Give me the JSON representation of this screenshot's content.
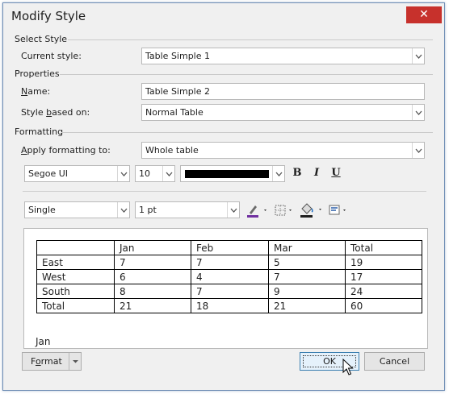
{
  "window": {
    "title": "Modify Style",
    "close_glyph": "✕"
  },
  "select_style": {
    "section_label": "Select Style",
    "current_style_label": "Current style:",
    "current_style_value": "Table Simple 1"
  },
  "properties": {
    "section_label": "Properties",
    "name_label_first": "N",
    "name_label_rest": "ame:",
    "name_value": "Table Simple 2",
    "based_on_label_pre": "Style ",
    "based_on_label_u": "b",
    "based_on_label_post": "ased on:",
    "based_on_value": "Normal Table"
  },
  "formatting": {
    "section_label": "Formatting",
    "apply_label_first": "A",
    "apply_label_rest": "pply formatting to:",
    "apply_value": "Whole table",
    "font_name": "Segoe UI",
    "font_size": "10",
    "font_color": "#000000",
    "bold_label": "B",
    "italic_label": "I",
    "underline_label": "U",
    "border_style": "Single",
    "border_width": "1 pt"
  },
  "preview": {
    "table": {
      "header": [
        "",
        "Jan",
        "Feb",
        "Mar",
        "Total"
      ],
      "rows": [
        [
          "East",
          "7",
          "7",
          "5",
          "19"
        ],
        [
          "West",
          "6",
          "4",
          "7",
          "17"
        ],
        [
          "South",
          "8",
          "7",
          "9",
          "24"
        ],
        [
          "Total",
          "21",
          "18",
          "21",
          "60"
        ]
      ]
    },
    "caption": "Jan"
  },
  "footer": {
    "format_label_pre": "F",
    "format_label_u": "o",
    "format_label_post": "rmat",
    "ok_label": "OK",
    "cancel_label": "Cancel"
  },
  "colors": {
    "accent_border": "#3c7fb1",
    "close_red": "#c7312c",
    "pen_underline": "#7030a0",
    "fill_swatch": "#1f1f1f"
  }
}
